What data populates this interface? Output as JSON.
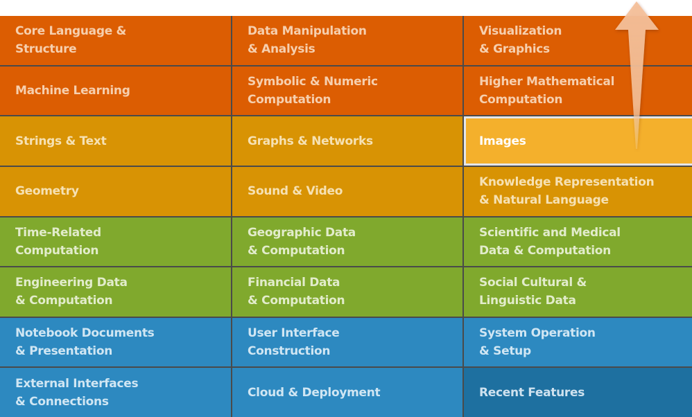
{
  "grid": {
    "rows": [
      [
        {
          "label": "Core Language &\nStructure",
          "color": "orange"
        },
        {
          "label": "Data Manipulation\n& Analysis",
          "color": "orange"
        },
        {
          "label": "Visualization\n& Graphics",
          "color": "orange"
        }
      ],
      [
        {
          "label": "Machine Learning",
          "color": "orange"
        },
        {
          "label": "Symbolic & Numeric\nComputation",
          "color": "orange"
        },
        {
          "label": "Higher Mathematical\nComputation",
          "color": "orange"
        }
      ],
      [
        {
          "label": "Strings & Text",
          "color": "amber"
        },
        {
          "label": "Graphs & Networks",
          "color": "amber"
        },
        {
          "label": "Images",
          "color": "highlight"
        }
      ],
      [
        {
          "label": "Geometry",
          "color": "amber"
        },
        {
          "label": "Sound & Video",
          "color": "amber"
        },
        {
          "label": "Knowledge Representation\n& Natural Language",
          "color": "amber"
        }
      ],
      [
        {
          "label": "Time-Related\nComputation",
          "color": "green"
        },
        {
          "label": "Geographic Data\n& Computation",
          "color": "green"
        },
        {
          "label": "Scientific and Medical\nData & Computation",
          "color": "green"
        }
      ],
      [
        {
          "label": "Engineering Data\n& Computation",
          "color": "green"
        },
        {
          "label": "Financial Data\n& Computation",
          "color": "green"
        },
        {
          "label": "Social Cultural &\nLinguistic Data",
          "color": "green"
        }
      ],
      [
        {
          "label": "Notebook Documents\n& Presentation",
          "color": "blue"
        },
        {
          "label": "User Interface\nConstruction",
          "color": "blue"
        },
        {
          "label": "System Operation\n& Setup",
          "color": "blue"
        }
      ],
      [
        {
          "label": "External Interfaces\n& Connections",
          "color": "blue"
        },
        {
          "label": "Cloud & Deployment",
          "color": "blue"
        },
        {
          "label": "Recent Features",
          "color": "blue-dark"
        }
      ]
    ]
  },
  "colors": {
    "orange": "#dc5d02",
    "amber": "#d89304",
    "highlight": "#f4b02c",
    "green": "#80a92d",
    "blue": "#2d89c0",
    "blue_dark": "#1e70a0",
    "arrow": "#f4c3a0"
  },
  "overlay": {
    "icon": "up-arrow-icon"
  }
}
